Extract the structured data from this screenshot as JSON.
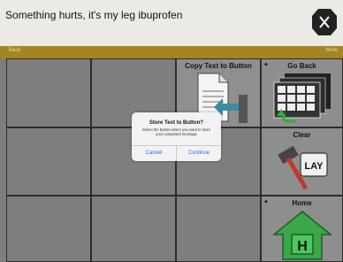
{
  "message": {
    "text": "Something hurts, it's my leg ibuprofen",
    "clear_icon": "x-clear-icon"
  },
  "nav": {
    "back_label": "Back",
    "more_label": "More"
  },
  "grid": {
    "copy_text_label": "Copy Text to Button",
    "go_back_label": "Go Back",
    "clear_label": "Clear",
    "home_label": "Home",
    "home_letter": "H",
    "clear_key_letter": "LAY",
    "corner_mark": "◆"
  },
  "dialog": {
    "title": "Store Text to Button?",
    "message": "Select the button where you want to store your composed message",
    "cancel_label": "Cancel",
    "continue_label": "Continue"
  },
  "colors": {
    "message_bar": "#eceae4",
    "nav_bar": "#a48522",
    "grid_bg": "#7e7e7e",
    "home_green": "#3aa84a",
    "dialog_button": "#2a6edb"
  }
}
